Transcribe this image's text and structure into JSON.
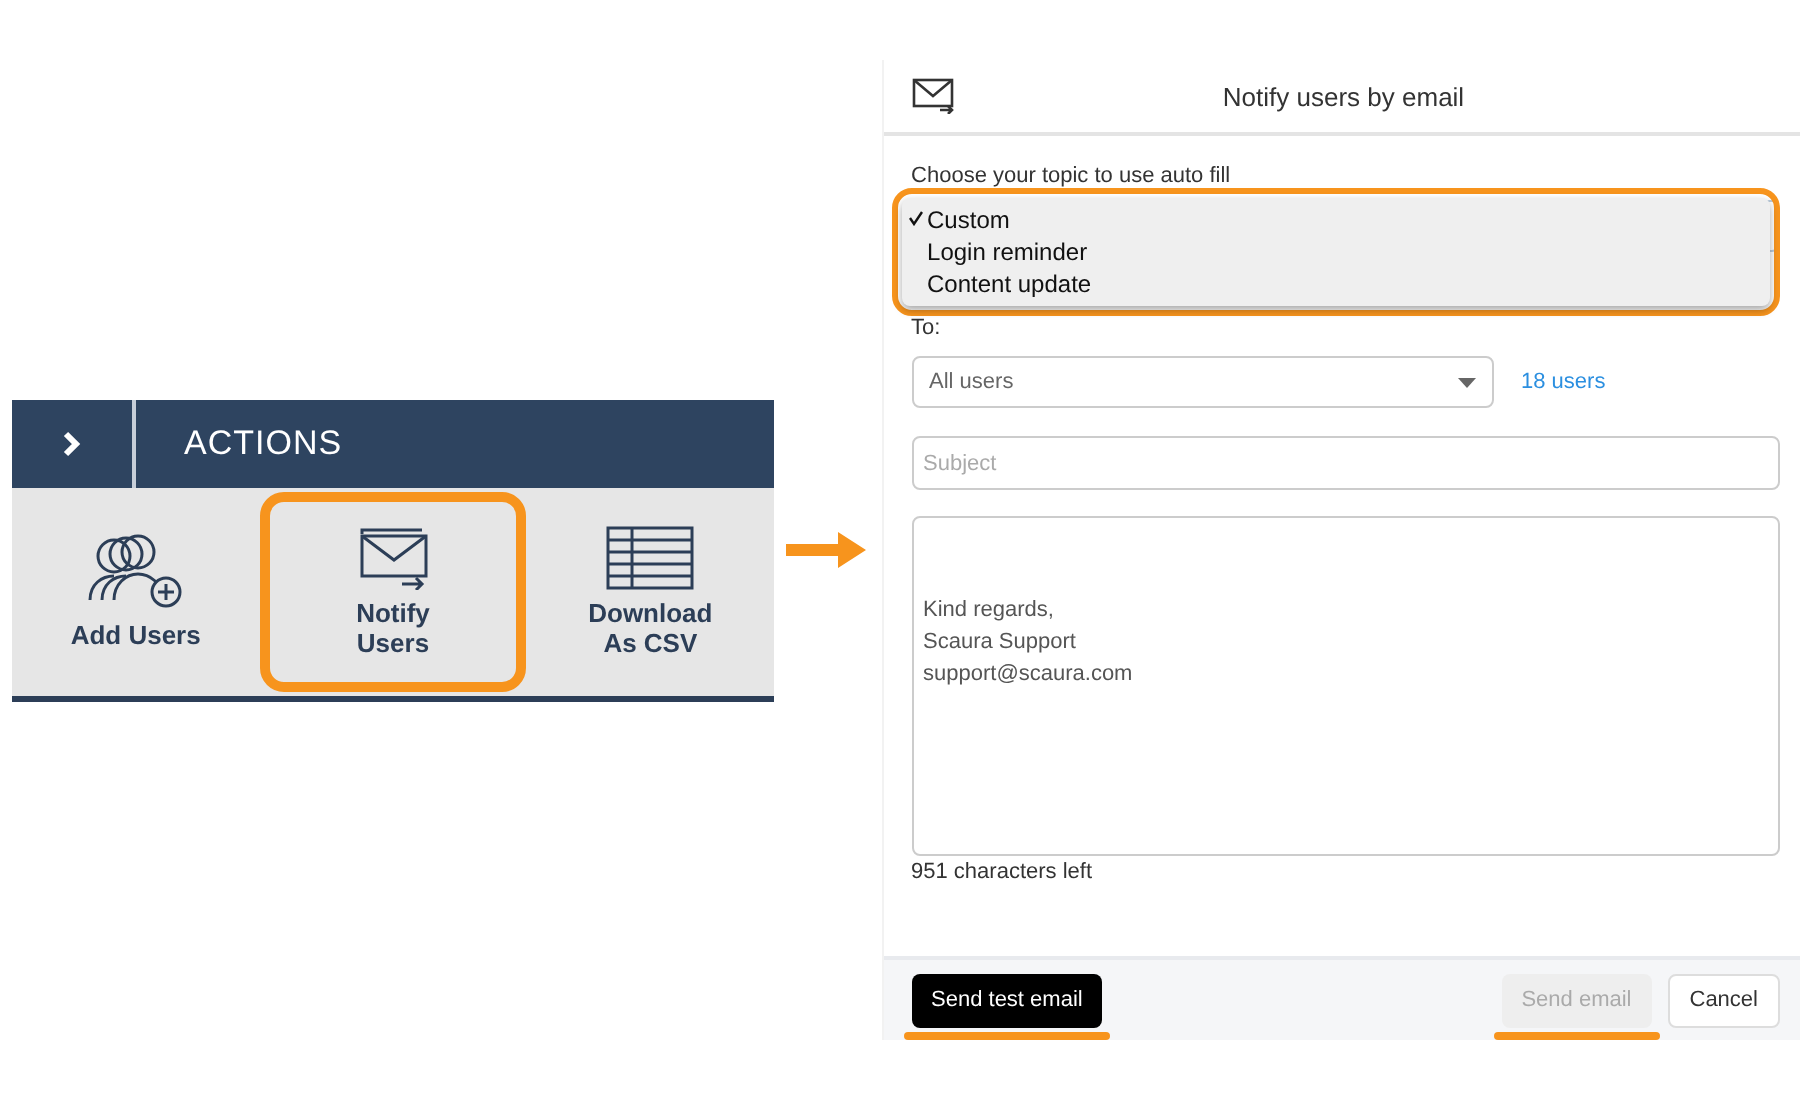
{
  "actions_panel": {
    "title": "ACTIONS",
    "items": [
      {
        "kind": "add-users",
        "label": "Add Users",
        "highlighted": false
      },
      {
        "kind": "notify",
        "label": "Notify Users",
        "highlighted": true
      },
      {
        "kind": "csv",
        "label": "Download As CSV",
        "highlighted": false
      }
    ]
  },
  "dialog": {
    "title": "Notify users by email",
    "topic_label": "Choose your topic to use auto fill",
    "topic_menu": {
      "highlighted": true,
      "options": [
        {
          "label": "Custom",
          "selected": true
        },
        {
          "label": "Login reminder",
          "selected": false
        },
        {
          "label": "Content update",
          "selected": false
        }
      ]
    },
    "to_label": "To:",
    "recipients": "All users",
    "recipient_count": "18 users",
    "subject_placeholder": "Subject",
    "message": "Kind regards,\nScaura Support\nsupport@scaura.com",
    "characters_left": "951 characters left",
    "buttons": [
      {
        "kind": "primary",
        "label": "Send test email",
        "disabled": false,
        "underlined": true
      },
      {
        "kind": "spacer"
      },
      {
        "kind": "secondary",
        "label": "Send email",
        "disabled": true,
        "underlined": true
      },
      {
        "kind": "secondary",
        "label": "Cancel",
        "disabled": false,
        "underlined": false
      }
    ]
  }
}
